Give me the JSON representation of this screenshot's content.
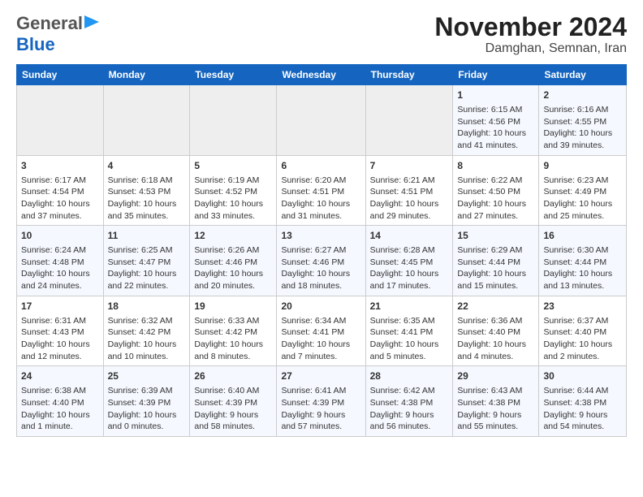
{
  "header": {
    "logo_line1": "General",
    "logo_line2": "Blue",
    "title": "November 2024",
    "subtitle": "Damghan, Semnan, Iran"
  },
  "weekdays": [
    "Sunday",
    "Monday",
    "Tuesday",
    "Wednesday",
    "Thursday",
    "Friday",
    "Saturday"
  ],
  "weeks": [
    [
      {
        "day": "",
        "content": ""
      },
      {
        "day": "",
        "content": ""
      },
      {
        "day": "",
        "content": ""
      },
      {
        "day": "",
        "content": ""
      },
      {
        "day": "",
        "content": ""
      },
      {
        "day": "1",
        "content": "Sunrise: 6:15 AM\nSunset: 4:56 PM\nDaylight: 10 hours\nand 41 minutes."
      },
      {
        "day": "2",
        "content": "Sunrise: 6:16 AM\nSunset: 4:55 PM\nDaylight: 10 hours\nand 39 minutes."
      }
    ],
    [
      {
        "day": "3",
        "content": "Sunrise: 6:17 AM\nSunset: 4:54 PM\nDaylight: 10 hours\nand 37 minutes."
      },
      {
        "day": "4",
        "content": "Sunrise: 6:18 AM\nSunset: 4:53 PM\nDaylight: 10 hours\nand 35 minutes."
      },
      {
        "day": "5",
        "content": "Sunrise: 6:19 AM\nSunset: 4:52 PM\nDaylight: 10 hours\nand 33 minutes."
      },
      {
        "day": "6",
        "content": "Sunrise: 6:20 AM\nSunset: 4:51 PM\nDaylight: 10 hours\nand 31 minutes."
      },
      {
        "day": "7",
        "content": "Sunrise: 6:21 AM\nSunset: 4:51 PM\nDaylight: 10 hours\nand 29 minutes."
      },
      {
        "day": "8",
        "content": "Sunrise: 6:22 AM\nSunset: 4:50 PM\nDaylight: 10 hours\nand 27 minutes."
      },
      {
        "day": "9",
        "content": "Sunrise: 6:23 AM\nSunset: 4:49 PM\nDaylight: 10 hours\nand 25 minutes."
      }
    ],
    [
      {
        "day": "10",
        "content": "Sunrise: 6:24 AM\nSunset: 4:48 PM\nDaylight: 10 hours\nand 24 minutes."
      },
      {
        "day": "11",
        "content": "Sunrise: 6:25 AM\nSunset: 4:47 PM\nDaylight: 10 hours\nand 22 minutes."
      },
      {
        "day": "12",
        "content": "Sunrise: 6:26 AM\nSunset: 4:46 PM\nDaylight: 10 hours\nand 20 minutes."
      },
      {
        "day": "13",
        "content": "Sunrise: 6:27 AM\nSunset: 4:46 PM\nDaylight: 10 hours\nand 18 minutes."
      },
      {
        "day": "14",
        "content": "Sunrise: 6:28 AM\nSunset: 4:45 PM\nDaylight: 10 hours\nand 17 minutes."
      },
      {
        "day": "15",
        "content": "Sunrise: 6:29 AM\nSunset: 4:44 PM\nDaylight: 10 hours\nand 15 minutes."
      },
      {
        "day": "16",
        "content": "Sunrise: 6:30 AM\nSunset: 4:44 PM\nDaylight: 10 hours\nand 13 minutes."
      }
    ],
    [
      {
        "day": "17",
        "content": "Sunrise: 6:31 AM\nSunset: 4:43 PM\nDaylight: 10 hours\nand 12 minutes."
      },
      {
        "day": "18",
        "content": "Sunrise: 6:32 AM\nSunset: 4:42 PM\nDaylight: 10 hours\nand 10 minutes."
      },
      {
        "day": "19",
        "content": "Sunrise: 6:33 AM\nSunset: 4:42 PM\nDaylight: 10 hours\nand 8 minutes."
      },
      {
        "day": "20",
        "content": "Sunrise: 6:34 AM\nSunset: 4:41 PM\nDaylight: 10 hours\nand 7 minutes."
      },
      {
        "day": "21",
        "content": "Sunrise: 6:35 AM\nSunset: 4:41 PM\nDaylight: 10 hours\nand 5 minutes."
      },
      {
        "day": "22",
        "content": "Sunrise: 6:36 AM\nSunset: 4:40 PM\nDaylight: 10 hours\nand 4 minutes."
      },
      {
        "day": "23",
        "content": "Sunrise: 6:37 AM\nSunset: 4:40 PM\nDaylight: 10 hours\nand 2 minutes."
      }
    ],
    [
      {
        "day": "24",
        "content": "Sunrise: 6:38 AM\nSunset: 4:40 PM\nDaylight: 10 hours\nand 1 minute."
      },
      {
        "day": "25",
        "content": "Sunrise: 6:39 AM\nSunset: 4:39 PM\nDaylight: 10 hours\nand 0 minutes."
      },
      {
        "day": "26",
        "content": "Sunrise: 6:40 AM\nSunset: 4:39 PM\nDaylight: 9 hours\nand 58 minutes."
      },
      {
        "day": "27",
        "content": "Sunrise: 6:41 AM\nSunset: 4:39 PM\nDaylight: 9 hours\nand 57 minutes."
      },
      {
        "day": "28",
        "content": "Sunrise: 6:42 AM\nSunset: 4:38 PM\nDaylight: 9 hours\nand 56 minutes."
      },
      {
        "day": "29",
        "content": "Sunrise: 6:43 AM\nSunset: 4:38 PM\nDaylight: 9 hours\nand 55 minutes."
      },
      {
        "day": "30",
        "content": "Sunrise: 6:44 AM\nSunset: 4:38 PM\nDaylight: 9 hours\nand 54 minutes."
      }
    ]
  ]
}
